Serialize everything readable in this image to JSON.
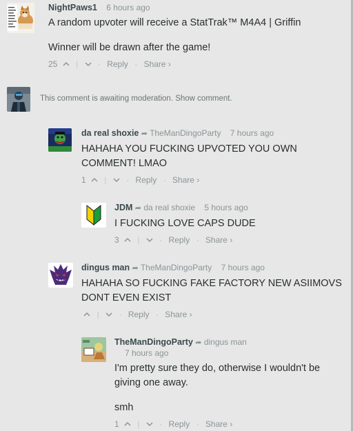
{
  "comments": [
    {
      "author": "NightPaws1",
      "parent": "",
      "time": "6 hours ago",
      "body": [
        "A random upvoter will receive a StatTrak™ M4A4 | Griffin",
        "Winner will be drawn after the game!"
      ],
      "votes": "25",
      "reply": "Reply",
      "share": "Share ›"
    },
    {
      "moderation": "This comment is awaiting moderation. Show comment."
    },
    {
      "author": "da real shoxie",
      "parent": "TheManDingoParty",
      "time": "7 hours ago",
      "body": [
        "HAHAHA YOU FUCKING UPVOTED YOU OWN COMMENT! LMAO"
      ],
      "votes": "1",
      "reply": "Reply",
      "share": "Share ›"
    },
    {
      "author": "JDM",
      "parent": "da real shoxie",
      "time": "5 hours ago",
      "body": [
        "I FUCKING LOVE CAPS DUDE"
      ],
      "votes": "3",
      "reply": "Reply",
      "share": "Share ›"
    },
    {
      "author": "dingus man",
      "parent": "TheManDingoParty",
      "time": "7 hours ago",
      "body": [
        "HAHAHA SO FUCKING FAKE FACTORY NEW ASIIMOVS DONT EVEN EXIST"
      ],
      "votes": "",
      "reply": "Reply",
      "share": "Share ›"
    },
    {
      "author": "TheManDingoParty",
      "parent": "dingus man",
      "time": "7 hours ago",
      "body": [
        "I'm pretty sure they do, otherwise I wouldn't be giving one away.",
        "smh"
      ],
      "votes": "1",
      "reply": "Reply",
      "share": "Share ›"
    }
  ],
  "icons": {
    "reply_arrow": "share-arrow-icon",
    "upvote": "chevron-up-icon",
    "downvote": "chevron-down-icon"
  }
}
